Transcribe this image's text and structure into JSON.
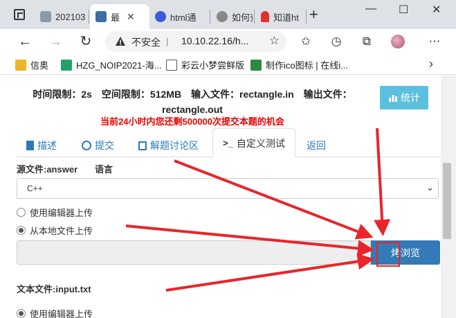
{
  "tabs": [
    {
      "label": "202103",
      "favicon_color": "#8c9aa8"
    },
    {
      "label": "最",
      "favicon_color": "#3a6ea5",
      "active": true
    },
    {
      "label": "html通",
      "favicon_color": "#3b5bdb"
    },
    {
      "label": "如何查",
      "favicon_color": "#888888"
    },
    {
      "label": "知道ht",
      "favicon_color": "#e03131"
    }
  ],
  "window": {
    "minimize": "—",
    "maximize": "☐",
    "close": "✕"
  },
  "address": {
    "insecure_label": "不安全",
    "divider": "|",
    "url": "10.10.22.16/h..."
  },
  "bookmarks": [
    {
      "label": "信奥",
      "icon_color": "#f0b429"
    },
    {
      "label": "HZG_NOIP2021-海...",
      "icon_color": "#21a366"
    },
    {
      "label": "彩云小梦尝鲜版",
      "icon_color": "#ffffff"
    },
    {
      "label": "制作ico图标 | 在线i...",
      "icon_color": "#2b8a3e"
    }
  ],
  "page": {
    "limits_line1": "时间限制：2s　空间限制：512MB　输入文件：rectangle.in　输出文件：",
    "limits_line2": "rectangle.out",
    "quota": "当前24小时内您还剩500000次提交本题的机会",
    "stats_button": "统计",
    "nav_tabs": [
      {
        "label": "描述",
        "icon": "book-icon"
      },
      {
        "label": "提交",
        "icon": "upload-circle-icon"
      },
      {
        "label": "解题讨论区",
        "icon": "list-icon"
      },
      {
        "label": "自定义测试",
        "icon": "terminal-icon",
        "active": true
      },
      {
        "label": "返回",
        "icon": ""
      }
    ],
    "source_label": "源文件:answer",
    "language_label": "语言",
    "language_value": "C++",
    "radio_editor": "使用编辑器上传",
    "radio_local": "从本地文件上传",
    "browse_button": "烤浏览",
    "text_file_label": "文本文件:input.txt",
    "radio_editor_2": "使用编辑器上传"
  },
  "colors": {
    "accent_blue": "#337ab7",
    "info_cyan": "#5bc0de",
    "quota_red": "#e00000",
    "arrow_red": "#e8252a"
  }
}
